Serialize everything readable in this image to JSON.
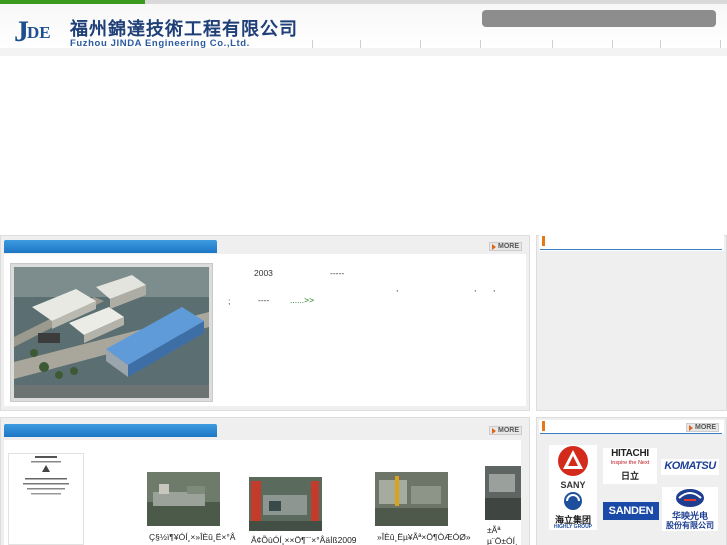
{
  "header": {
    "logo_j": "J",
    "logo_de": "DE",
    "company_cn": "福州錦達技術工程有限公司",
    "company_en": "Fuzhou JINDA Engineering Co.,Ltd."
  },
  "nav": {
    "item_count": 8
  },
  "intro": {
    "year": "2003",
    "dashes": "-----",
    "comma_1": ",",
    "comma_2": ",",
    "comma_3": ",",
    "semicolon": ";",
    "dashes_2": "----",
    "more_link": "......>>",
    "more_label": "MORE"
  },
  "products": {
    "more_label": "MORE",
    "items": [
      {
        "caption": "Ç§½ï¶¥ÓÍ¸×»ÎÈû¸Ë×°Å"
      },
      {
        "caption": "Â¢ÕùÓÍ¸××Ö¶¨¨×°Åäİß2009"
      },
      {
        "caption": "»ÎÈû¸Ëµ¥Ãª×Ö¶ÒÆÓØ»"
      },
      {
        "caption": "±Ãª"
      },
      {
        "caption": "µ¨Ö±ÓÍ¸"
      }
    ]
  },
  "partners": {
    "more_label": "MORE",
    "sany": "SANY",
    "hitachi": "HITACHI",
    "hitachi_tagline": "Inspire the Next",
    "hitachi_cn": "日立",
    "komatsu": "KOMATSU",
    "highly_cn": "海立集团",
    "highly_en": "HIGHLY GROUP",
    "sanden": "SANDEN",
    "huaying_cn": "华映光电",
    "huaying_cn2": "股份有限公司"
  },
  "colors": {
    "brand_blue": "#1e4f8f",
    "tab_blue": "#2a86d4",
    "accent_orange": "#e67817",
    "top_green": "#3a9a1e",
    "link_green": "#1f7a1f"
  }
}
